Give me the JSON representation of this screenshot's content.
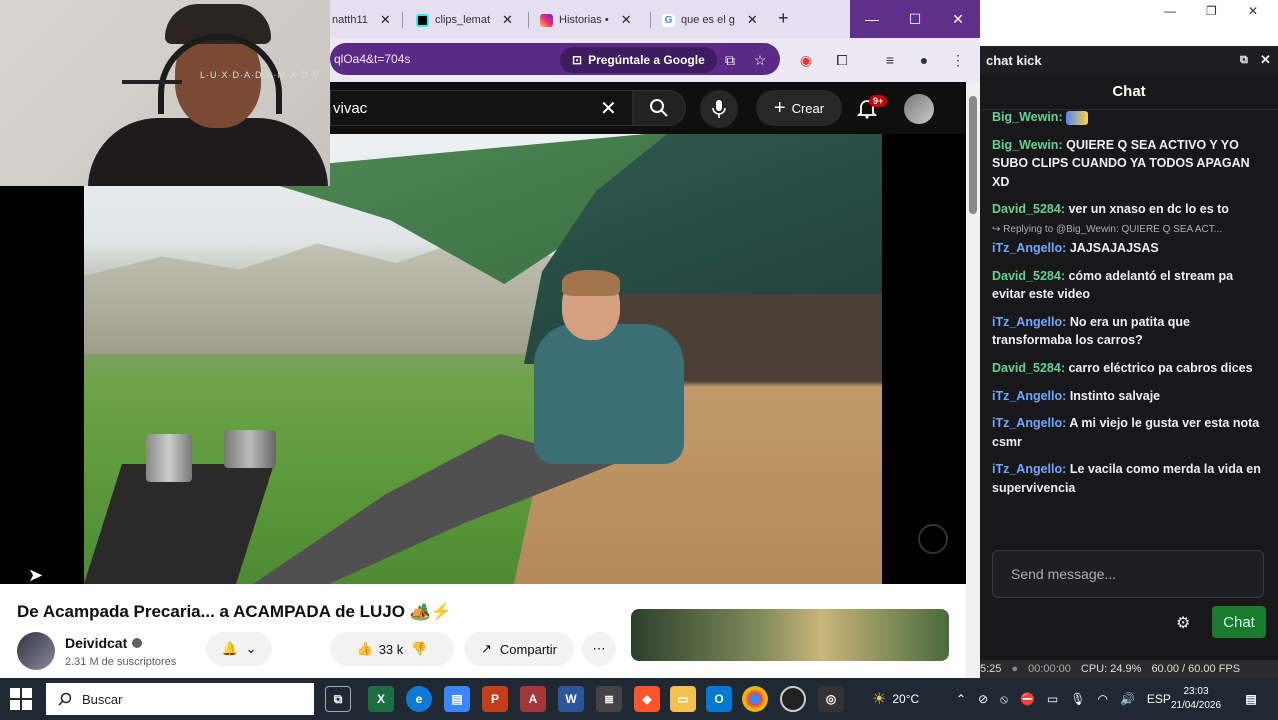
{
  "browser": {
    "tabs": [
      {
        "label": "natth11",
        "color": "#b44"
      },
      {
        "label": "clips_lemat",
        "color": "#000"
      },
      {
        "label": "Historias •",
        "color": "#d6297c"
      },
      {
        "label": "que es el g",
        "color": "#4285f4"
      }
    ],
    "new_tab": "+",
    "window_controls": {
      "minimize": "—",
      "maximize": "☐",
      "close": "✕"
    },
    "address_text": "qlOa4&t=704s",
    "ask_google": "Pregúntale a Google"
  },
  "youtube": {
    "search_value": "vivac",
    "create_label": "Crear",
    "notif_count": "9+",
    "video_title": "De Acampada Precaria... a ACAMPADA de LUJO 🏕️⚡",
    "channel_name": "Deividcat",
    "subscribers": "2.31 M de suscriptores",
    "likes": "33 k",
    "share_label": "Compartir"
  },
  "webcam": {
    "tag": "L·U·X·D·A·D·A·M·X·D·D"
  },
  "chat": {
    "window_title": "chat kick",
    "header": "Chat",
    "messages": [
      {
        "user": "Big_Wewin",
        "text": "",
        "color": "green",
        "emote": true
      },
      {
        "user": "Big_Wewin",
        "text": "QUIERE Q SEA ACTIVO Y YO SUBO CLIPS CUANDO YA TODOS APAGAN XD",
        "color": "green"
      },
      {
        "user": "David_5284",
        "text": "ver un xnaso en dc lo es to",
        "color": "green"
      },
      {
        "user": "iTz_Angello",
        "text": "JAJSAJAJSAS",
        "color": "blue",
        "reply": "↪ Replying to @Big_Wewin: QUIERE Q SEA ACT..."
      },
      {
        "user": "David_5284",
        "text": "cómo adelantó el stream pa evitar este video",
        "color": "green"
      },
      {
        "user": "iTz_Angello",
        "text": "No era un patita que transformaba los carros?",
        "color": "blue"
      },
      {
        "user": "David_5284",
        "text": "carro eléctrico pa cabros dices",
        "color": "green"
      },
      {
        "user": "iTz_Angello",
        "text": "Instinto salvaje",
        "color": "blue"
      },
      {
        "user": "iTz_Angello",
        "text": "A mi viejo le gusta ver esta nota csmr",
        "color": "blue"
      },
      {
        "user": "iTz_Angello",
        "text": "Le vacila como merda la vida en supervivencia",
        "color": "blue"
      }
    ],
    "input_placeholder": "Send message...",
    "send_label": "Chat"
  },
  "obs": {
    "left": "5:25",
    "rec": "00:00:00",
    "cpu": "CPU: 24.9%",
    "fps": "60.00 / 60.00 FPS"
  },
  "taskbar": {
    "search_placeholder": "Buscar",
    "weather": "20°C",
    "lang": "ESP",
    "time": "23:03",
    "date": "21/04/2026"
  }
}
